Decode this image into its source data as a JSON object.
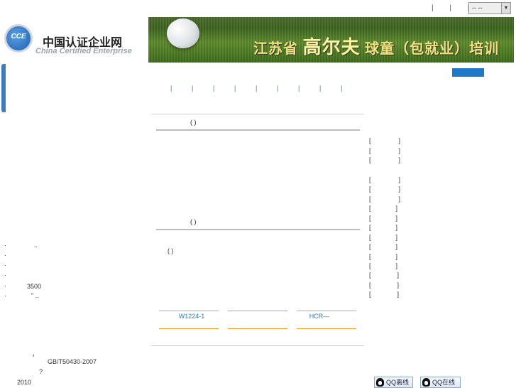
{
  "topbar": {
    "separators": "| | |",
    "lang_select_value": "-- --"
  },
  "logo": {
    "badge": "CCE",
    "cn": "中国认证企业网",
    "en": "China Certified Enterprise"
  },
  "banner": {
    "part1": "江苏省",
    "part2": "高尔夫",
    "part3": "球童（包就业）培训"
  },
  "nav": {
    "items": [
      "|",
      "|",
      "|",
      "|",
      "|",
      "|",
      "|",
      "|",
      "|"
    ]
  },
  "sections": {
    "title1": "(  )",
    "title2": "(  )",
    "paren_text": "( )"
  },
  "tabs": [
    "W1224-1",
    "",
    "HCR—"
  ],
  "right_list": [
    "[",
    "[",
    "[",
    "[",
    "[",
    "[",
    "[",
    "[",
    "[",
    "[",
    "[",
    "[",
    "[",
    "[",
    "[",
    "["
  ],
  "left_list": [
    {
      "bullet": "·",
      "text": "..",
      "x": 44
    },
    {
      "bullet": "·",
      "text": "",
      "x": 0
    },
    {
      "bullet": "·",
      "text": "",
      "x": 0
    },
    {
      "bullet": "·",
      "text": "",
      "x": 0
    },
    {
      "bullet": "·",
      "text": "3500",
      "x": 34
    },
    {
      "bullet": "·",
      "text": "\" ..",
      "x": 40
    }
  ],
  "left_bottom": {
    "comma": "，",
    "std": "GB/T50430-2007",
    "q": "?",
    "year": "2010"
  },
  "qq": {
    "offline": "QQ离线",
    "online": "QQ在线"
  }
}
